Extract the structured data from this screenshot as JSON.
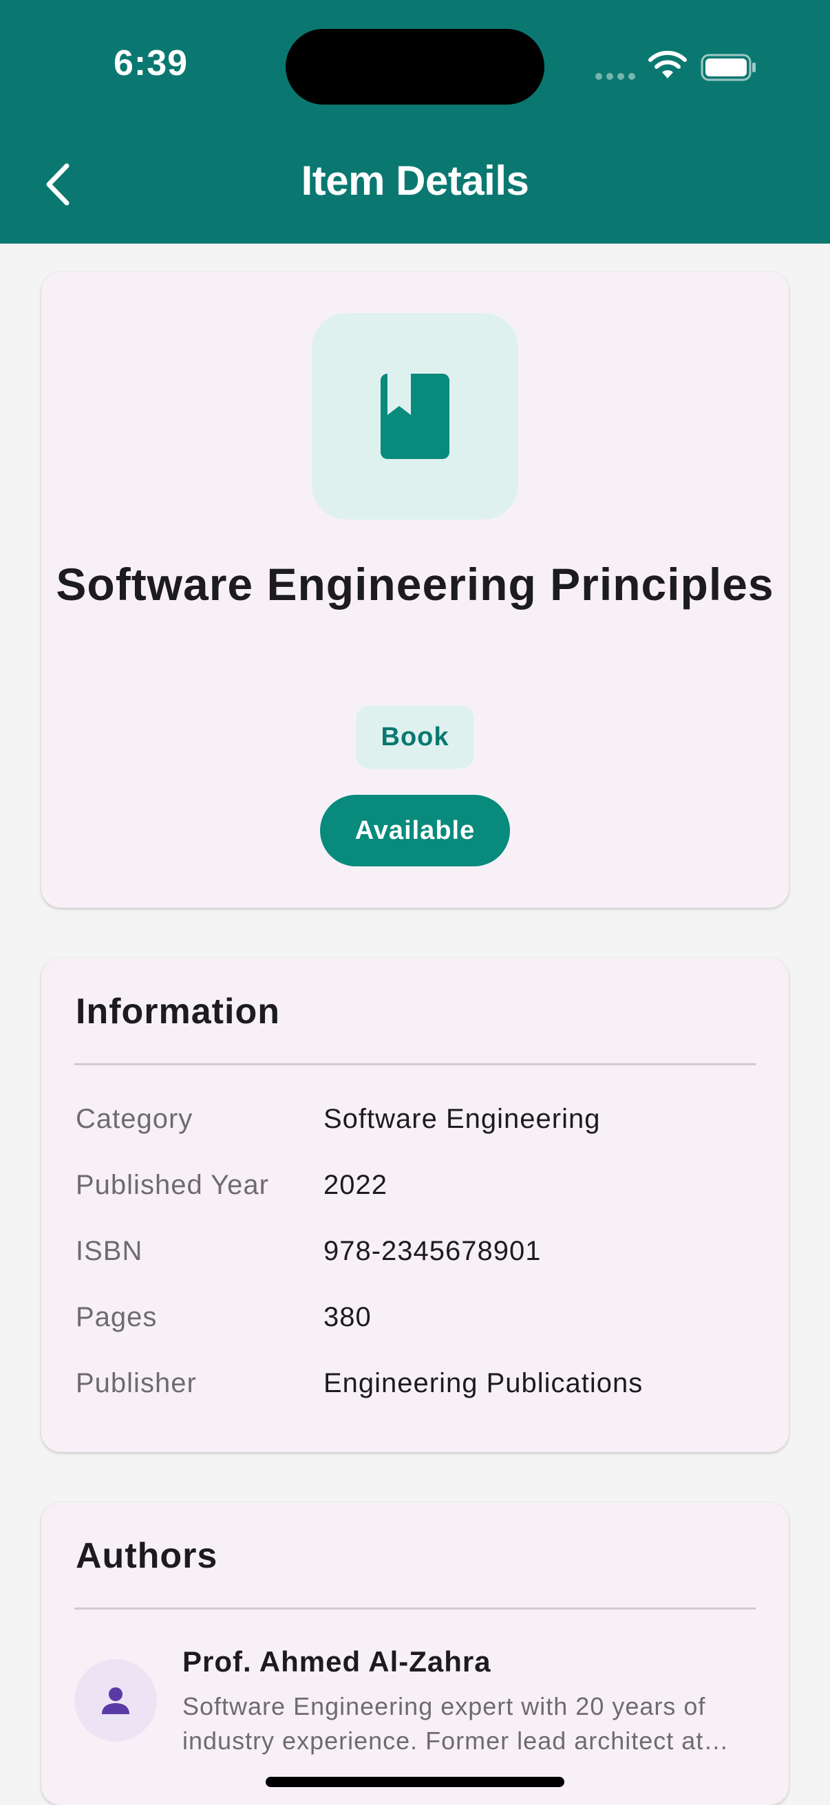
{
  "status_bar": {
    "time": "6:39"
  },
  "app_bar": {
    "title": "Item Details",
    "back_icon": "chevron-left-icon"
  },
  "item": {
    "icon": "book-icon",
    "title": "Software Engineering Principles",
    "type": "Book",
    "status": "Available"
  },
  "information": {
    "heading": "Information",
    "rows": [
      {
        "label": "Category",
        "value": "Software Engineering"
      },
      {
        "label": "Published Year",
        "value": "2022"
      },
      {
        "label": "ISBN",
        "value": "978-2345678901"
      },
      {
        "label": "Pages",
        "value": "380"
      },
      {
        "label": "Publisher",
        "value": "Engineering Publications"
      }
    ]
  },
  "authors": {
    "heading": "Authors",
    "items": [
      {
        "name": "Prof. Ahmed Al-Zahra",
        "bio": "Software Engineering expert with 20 years of industry experience. Former lead architect at…",
        "icon": "person-icon"
      }
    ]
  },
  "colors": {
    "primary": "#0a7870",
    "chip_bg": "#dff1ef",
    "card_bg": "#f7f1f7",
    "avatar_bg": "#ece4f5",
    "avatar_icon": "#5b3aa6"
  }
}
